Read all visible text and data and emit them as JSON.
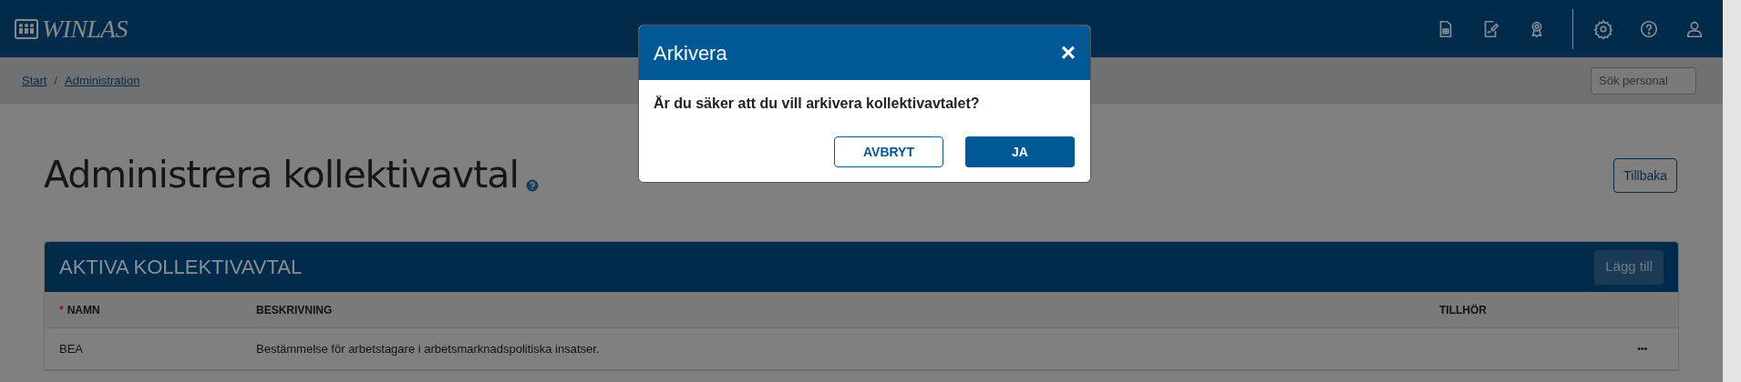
{
  "app": {
    "logo": "WINLAS"
  },
  "breadcrumb": [
    {
      "label": "Start"
    },
    {
      "label": "Administration"
    }
  ],
  "breadcrumb_separator": "/",
  "search": {
    "placeholder": "Sök personal"
  },
  "page": {
    "title": "Administrera kollektivavtal",
    "back_button": "Tillbaka"
  },
  "card": {
    "title": "AKTIVA KOLLEKTIVAVTAL",
    "add_button": "Lägg till",
    "required_mark": "*",
    "columns": [
      {
        "label": "NAMN",
        "required": true
      },
      {
        "label": "BESKRIVNING",
        "required": false
      },
      {
        "label": "TILLHÖR",
        "required": false
      }
    ],
    "rows": [
      {
        "cells": [
          "BEA",
          "Bestämmelse för arbetstagare i arbetsmarknadspolitiska insatser."
        ],
        "menu": "•••"
      }
    ]
  },
  "dialog": {
    "title": "Arkivera",
    "close": "×",
    "message": "Är du säker att du vill arkivera kollektivavtalet?",
    "buttons": [
      {
        "label": "AVBRYT",
        "kind": "secondary"
      },
      {
        "label": "JA",
        "kind": "primary"
      }
    ]
  }
}
